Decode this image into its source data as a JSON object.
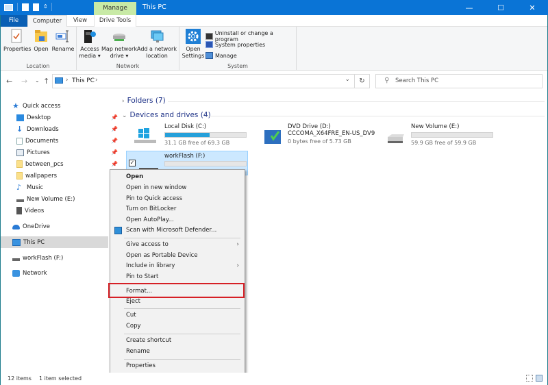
{
  "window": {
    "title": "This PC",
    "contextual_tab_group": "Manage",
    "controls": {
      "minimize": "—",
      "maximize": "☐",
      "close": "✕"
    }
  },
  "ribbon_tabs": [
    {
      "label": "File",
      "active": false
    },
    {
      "label": "Computer",
      "active": true
    },
    {
      "label": "View",
      "active": false
    },
    {
      "label": "Drive Tools",
      "active": false
    }
  ],
  "ribbon": {
    "groups": [
      {
        "label": "Location",
        "buttons": [
          "Properties",
          "Open",
          "Rename"
        ]
      },
      {
        "label": "Network",
        "buttons": [
          "Access media ▾",
          "Map network drive ▾",
          "Add a network location"
        ]
      },
      {
        "label": "System",
        "buttons": [
          "Open Settings"
        ],
        "items": [
          "Uninstall or change a program",
          "System properties",
          "Manage"
        ]
      }
    ],
    "location": {
      "label": "Location",
      "properties": "Properties",
      "open": "Open",
      "rename": "Rename"
    },
    "network": {
      "label": "Network",
      "access_media_1": "Access",
      "access_media_2": "media ▾",
      "map_drive_1": "Map network",
      "map_drive_2": "drive ▾",
      "add_location_1": "Add a network",
      "add_location_2": "location"
    },
    "system": {
      "label": "System",
      "open_settings_1": "Open",
      "open_settings_2": "Settings",
      "uninstall": "Uninstall or change a program",
      "sys_props": "System properties",
      "manage": "Manage"
    }
  },
  "address_bar": {
    "breadcrumb": [
      "This PC"
    ],
    "path_label": "This PC",
    "search_placeholder": "Search This PC"
  },
  "nav_buttons": {
    "back": "←",
    "forward": "→",
    "recent": "⌄",
    "up": "↑",
    "dropdown": "⌄",
    "refresh": "↻"
  },
  "sidebar": {
    "quick_access": "Quick access",
    "items": [
      {
        "label": "Desktop",
        "pinned": true
      },
      {
        "label": "Downloads",
        "pinned": true
      },
      {
        "label": "Documents",
        "pinned": true
      },
      {
        "label": "Pictures",
        "pinned": true
      },
      {
        "label": "between_pcs",
        "pinned": true
      },
      {
        "label": "wallpapers",
        "pinned": false
      },
      {
        "label": "Music",
        "pinned": false
      },
      {
        "label": "New Volume (E:)",
        "pinned": false
      },
      {
        "label": "Videos",
        "pinned": false
      }
    ],
    "onedrive": "OneDrive",
    "this_pc": "This PC",
    "workflash": "workFlash (F:)",
    "network": "Network"
  },
  "content": {
    "folders_header": "Folders (7)",
    "devices_header": "Devices and drives (4)",
    "drives": [
      {
        "name": "Local Disk (C:)",
        "subtitle": "31.1 GB free of 69.3 GB",
        "used_fraction": 0.55
      },
      {
        "name": "DVD Drive (D:)",
        "subtitle_1": "CCCOMA_X64FRE_EN-US_DV9",
        "subtitle": "0 bytes free of 5.73 GB"
      },
      {
        "name": "New Volume (E:)",
        "subtitle": "59.9 GB free of 59.9 GB",
        "used_fraction": 0.0
      },
      {
        "name": "workFlash (F:)",
        "used_fraction": 0.0,
        "selected": true
      }
    ]
  },
  "context_menu": {
    "items": [
      {
        "label": "Open",
        "bold": true
      },
      {
        "label": "Open in new window"
      },
      {
        "label": "Pin to Quick access"
      },
      {
        "label": "Turn on BitLocker"
      },
      {
        "label": "Open AutoPlay..."
      },
      {
        "label": "Scan with Microsoft Defender..."
      },
      {
        "label": "Give access to",
        "submenu": true
      },
      {
        "label": "Open as Portable Device"
      },
      {
        "label": "Include in library",
        "submenu": true
      },
      {
        "label": "Pin to Start"
      },
      {
        "label": "Format...",
        "highlighted": true
      },
      {
        "label": "Eject"
      },
      {
        "label": "Cut"
      },
      {
        "label": "Copy"
      },
      {
        "label": "Create shortcut"
      },
      {
        "label": "Rename"
      },
      {
        "label": "Properties"
      }
    ],
    "submenu_arrow": "›"
  },
  "status_bar": {
    "item_count": "12 items",
    "selection": "1 item selected"
  },
  "colors": {
    "titlebar": "#0a74d6",
    "manage_tab": "#c8eaa6",
    "selection": "#cce8ff",
    "progress_fill": "#26a0da",
    "highlight_box": "#d62026"
  }
}
